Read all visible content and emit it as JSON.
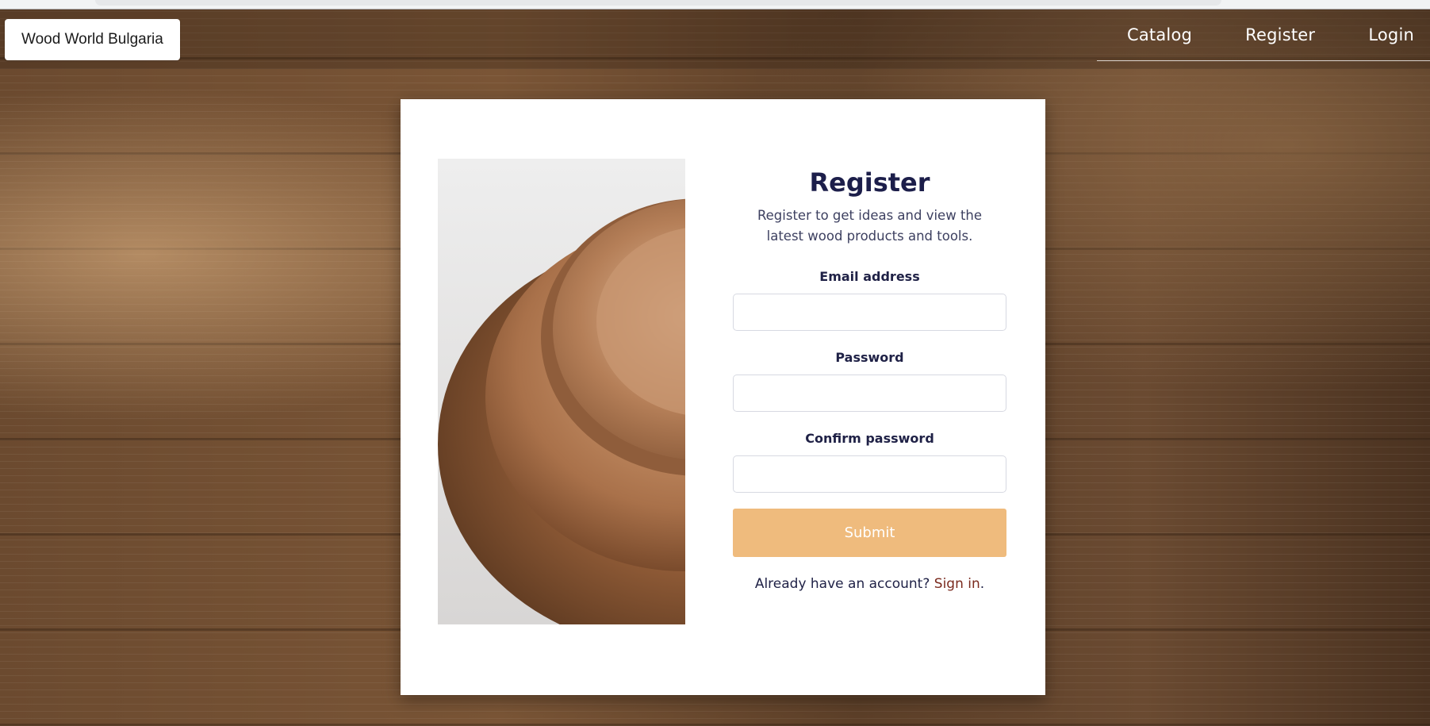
{
  "header": {
    "brand": "Wood World Bulgaria",
    "nav": [
      {
        "label": "Catalog"
      },
      {
        "label": "Register"
      },
      {
        "label": "Login"
      }
    ]
  },
  "form": {
    "title": "Register",
    "subtitle": "Register to get ideas and view the latest wood products and tools.",
    "fields": {
      "email_label": "Email address",
      "password_label": "Password",
      "confirm_label": "Confirm password"
    },
    "submit_label": "Submit",
    "signin_prompt": "Already have an account?",
    "signin_link": "Sign in",
    "signin_suffix": "."
  },
  "colors": {
    "title": "#1c1e4a",
    "submit": "#efbb7d",
    "signin_link": "#7a2a1e"
  }
}
